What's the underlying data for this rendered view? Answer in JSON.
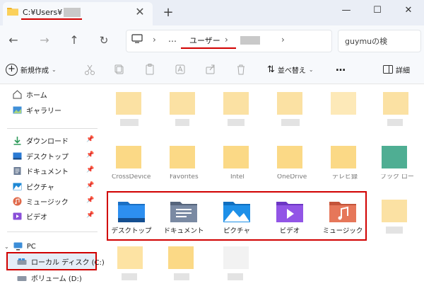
{
  "tab": {
    "title": "C:¥Users¥",
    "close": "✕",
    "new_tab": "+"
  },
  "window": {
    "minimize": "—",
    "maximize": "☐",
    "close": "✕"
  },
  "address": {
    "path_more": "…",
    "path_user": "ユーザー",
    "separator": "›",
    "search_placeholder": "guymuの検"
  },
  "toolbar": {
    "new_label": "新規作成",
    "sort_label": "並べ替え",
    "more_label": "…",
    "details_label": "詳細"
  },
  "sidebar": {
    "home": "ホーム",
    "gallery": "ギャラリー",
    "quick": [
      {
        "label": "ダウンロード",
        "icon": "download-icon"
      },
      {
        "label": "デスクトップ",
        "icon": "desktop-icon"
      },
      {
        "label": "ドキュメント",
        "icon": "documents-icon"
      },
      {
        "label": "ピクチャ",
        "icon": "pictures-icon"
      },
      {
        "label": "ミュージック",
        "icon": "music-icon"
      },
      {
        "label": "ビデオ",
        "icon": "videos-icon"
      }
    ],
    "pc": "PC",
    "local_disk": "ローカル ディスク (C:)",
    "volume_d": "ボリューム (D:)"
  },
  "content": {
    "cut_labels": [
      "CrossDevice",
      "Favorites",
      "Intel",
      "OneDrive",
      "テレビ録",
      "ブック ロー"
    ],
    "libraries": [
      {
        "label": "デスクトップ",
        "icon": "desktop-folder-icon"
      },
      {
        "label": "ドキュメント",
        "icon": "documents-folder-icon"
      },
      {
        "label": "ピクチャ",
        "icon": "pictures-folder-icon"
      },
      {
        "label": "ビデオ",
        "icon": "videos-folder-icon"
      },
      {
        "label": "ミュージック",
        "icon": "music-folder-icon"
      }
    ]
  },
  "colors": {
    "highlight": "#d10000",
    "folder": "#f9c74f",
    "selection": "#e5edf7"
  }
}
